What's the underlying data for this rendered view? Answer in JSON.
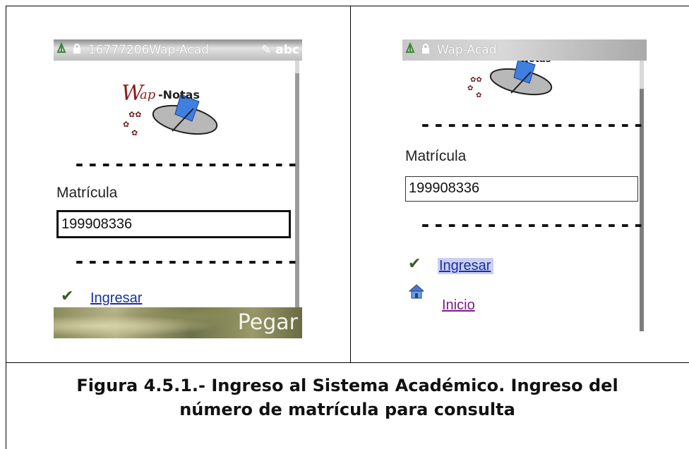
{
  "left_screen": {
    "status_title": "16777206Wap-Acad",
    "status_mode": "abc",
    "logo_text": "Wap-Notas",
    "separator": "-----------------",
    "field_label": "Matrícula",
    "field_value": "199908336",
    "link_ingresar": "Ingresar",
    "softkey_right": "Pegar"
  },
  "right_screen": {
    "status_title": "Wap-Acad",
    "logo_text": "Notas",
    "separator": "-----------------",
    "field_label": "Matrícula",
    "field_value": "199908336",
    "link_ingresar": "Ingresar",
    "link_inicio": "Inicio"
  },
  "caption": {
    "line1": "Figura 4.5.1.-  Ingreso al Sistema Académico. Ingreso del",
    "line2": "número de matrícula para consulta"
  },
  "colors": {
    "link_blue": "#1a2fa0",
    "link_visited": "#7a1b8a",
    "highlight": "#c8cff2"
  }
}
